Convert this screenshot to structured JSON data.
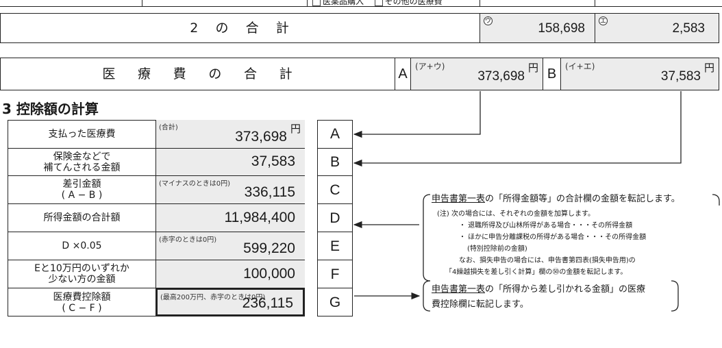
{
  "top": {
    "checkbox_a": "医薬品購入",
    "checkbox_b": "その他の医療費"
  },
  "sum2": {
    "label": [
      "2",
      "の",
      "合",
      "計"
    ],
    "mark_u": "ウ",
    "value_u": "158,698",
    "mark_e": "エ",
    "value_e": "2,583"
  },
  "total": {
    "label": [
      "医",
      "療",
      "費",
      "の",
      "合",
      "計"
    ],
    "a_letter": "A",
    "a_formula": "(ア+ウ)",
    "a_value": "373,698",
    "a_unit": "円",
    "b_letter": "B",
    "b_formula": "(イ+エ)",
    "b_value": "37,583",
    "b_unit": "円"
  },
  "section3": {
    "title": "3 控除額の計算",
    "rows": [
      {
        "label": "支払った医療費",
        "note": "(合計)",
        "value": "373,698",
        "unit": "円",
        "letter": "A"
      },
      {
        "label": "保険金などで\n補てんされる金額",
        "note": "",
        "value": "37,583",
        "unit": "",
        "letter": "B"
      },
      {
        "label": "差引金額\n( A − B )",
        "note": "(マイナスのときは0円)",
        "value": "336,115",
        "unit": "",
        "letter": "C"
      },
      {
        "label": "所得金額の合計額",
        "note": "",
        "value": "11,984,400",
        "unit": "",
        "letter": "D"
      },
      {
        "label": "D ×0.05",
        "note": "(赤字のときは0円)",
        "value": "599,220",
        "unit": "",
        "letter": "E"
      },
      {
        "label": "Eと10万円のいずれか\n少ない方の金額",
        "note": "",
        "value": "100,000",
        "unit": "",
        "letter": "F"
      },
      {
        "label": "医療費控除額\n( C − F )",
        "note": "(最高200万円、赤字のときは0円)",
        "value": "236,115",
        "unit": "",
        "letter": "G"
      }
    ]
  },
  "note_d": {
    "heading_u": "申告書第一表",
    "heading_rest": "の「所得金額等」の合計欄の金額を転記します。",
    "lines": [
      "(注)  次の場合には、それぞれの金額を加算します。",
      "・ 退職所得及び山林所得がある場合・・・その所得金額",
      "・ ほかに申告分離課税の所得がある場合・・・その所得金額",
      "(特別控除前の金額)",
      "なお、損失申告の場合には、申告書第四表(損失申告用)の",
      "「4繰越損失を差し引く計算」欄の㊿の金額を転記します。"
    ]
  },
  "note_g": {
    "heading_u": "申告書第一表",
    "heading_rest": "の「所得から差し引かれる金額」の医療",
    "line2": "費控除欄に転記します。"
  }
}
